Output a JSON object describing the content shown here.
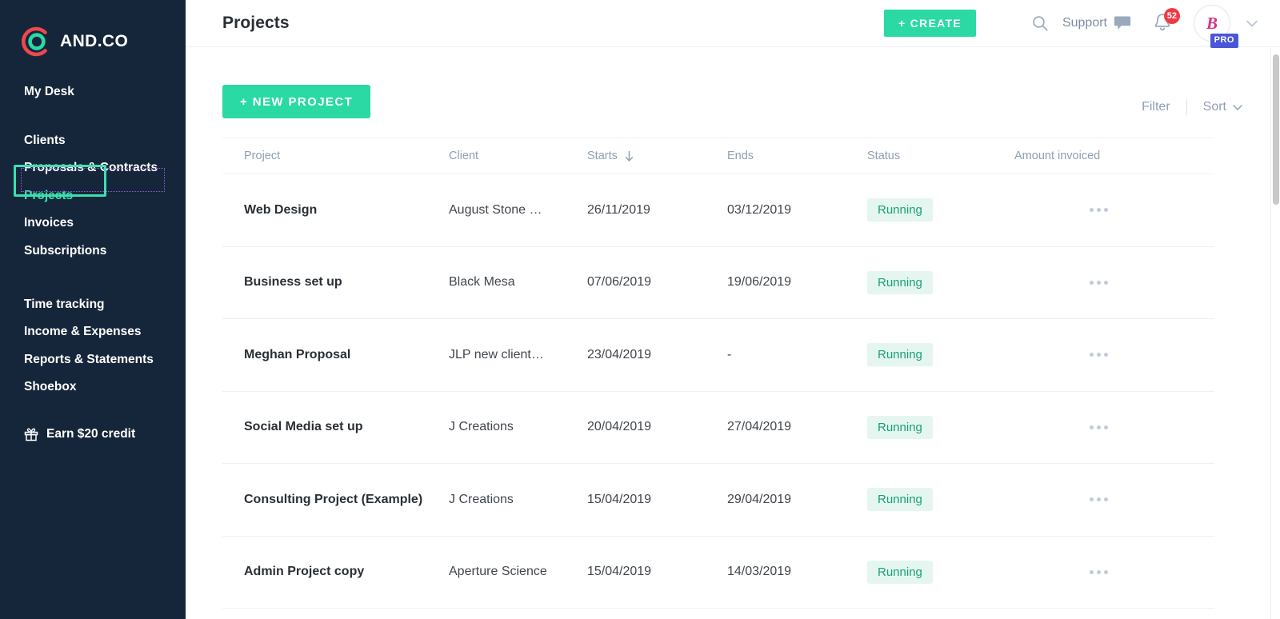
{
  "brand": {
    "name": "AND.CO",
    "logo_icon": "andco-logo-icon",
    "logo_colors": {
      "arc": "#f0484f",
      "ring": "#2ad9a4"
    }
  },
  "sidebar": {
    "bg_color": "#16263a",
    "active_color": "#3ce0b0",
    "groups": [
      {
        "items": [
          {
            "label": "My Desk",
            "name": "my-desk",
            "active": false
          }
        ]
      },
      {
        "items": [
          {
            "label": "Clients",
            "name": "clients",
            "active": false
          },
          {
            "label": "Proposals & Contracts",
            "name": "proposals-contracts",
            "active": false
          },
          {
            "label": "Projects",
            "name": "projects",
            "active": true
          },
          {
            "label": "Invoices",
            "name": "invoices",
            "active": false
          },
          {
            "label": "Subscriptions",
            "name": "subscriptions",
            "active": false
          }
        ]
      },
      {
        "items": [
          {
            "label": "Time tracking",
            "name": "time-tracking",
            "active": false
          },
          {
            "label": "Income & Expenses",
            "name": "income-expenses",
            "active": false
          },
          {
            "label": "Reports & Statements",
            "name": "reports-statements",
            "active": false
          },
          {
            "label": "Shoebox",
            "name": "shoebox",
            "active": false
          }
        ]
      }
    ],
    "credit": {
      "label": "Earn $20 credit",
      "icon": "gift-icon"
    }
  },
  "header": {
    "title": "Projects",
    "create_label": "+ CREATE",
    "play_icon": "play-icon",
    "search_icon": "search-icon",
    "support_label": "Support",
    "support_icon": "speech-bubble-icon",
    "bell_icon": "bell-icon",
    "notification_count": "52",
    "avatar_monogram": "B",
    "pro_badge": "PRO",
    "chevron_icon": "chevron-down-icon",
    "accent_color": "#2ad9a4"
  },
  "toolbar": {
    "new_project_label": "+  NEW PROJECT",
    "filter_label": "Filter",
    "sort_label": "Sort",
    "sort_chevron_icon": "chevron-down-icon"
  },
  "table": {
    "columns": [
      {
        "label": "Project",
        "name": "project"
      },
      {
        "label": "Client",
        "name": "client"
      },
      {
        "label": "Starts",
        "name": "starts",
        "sorted": true,
        "sort_icon": "arrow-down-icon"
      },
      {
        "label": "Ends",
        "name": "ends"
      },
      {
        "label": "Status",
        "name": "status"
      },
      {
        "label": "Amount invoiced",
        "name": "amount-invoiced"
      }
    ],
    "rows": [
      {
        "project": "Web Design",
        "client": "August Stone …",
        "starts": "26/11/2019",
        "ends": "03/12/2019",
        "status": "Running",
        "amount": ""
      },
      {
        "project": "Business set up",
        "client": "Black Mesa",
        "starts": "07/06/2019",
        "ends": "19/06/2019",
        "status": "Running",
        "amount": ""
      },
      {
        "project": "Meghan Proposal",
        "client": "JLP new client…",
        "starts": "23/04/2019",
        "ends": "-",
        "status": "Running",
        "amount": ""
      },
      {
        "project": "Social Media set up",
        "client": "J Creations",
        "starts": "20/04/2019",
        "ends": "27/04/2019",
        "status": "Running",
        "amount": ""
      },
      {
        "project": "Consulting Project (Example)",
        "client": "J Creations",
        "starts": "15/04/2019",
        "ends": "29/04/2019",
        "status": "Running",
        "amount": ""
      },
      {
        "project": "Admin Project copy",
        "client": "Aperture Science",
        "starts": "15/04/2019",
        "ends": "14/03/2019",
        "status": "Running",
        "amount": ""
      }
    ],
    "row_menu_icon": "more-options-icon",
    "status_colors": {
      "running_bg": "#e4f6ef",
      "running_text": "#1aa179"
    }
  },
  "annotations": {
    "highlight_box_color": "#3ce0b0",
    "inspector_outline_color": "#8b5cd6"
  }
}
